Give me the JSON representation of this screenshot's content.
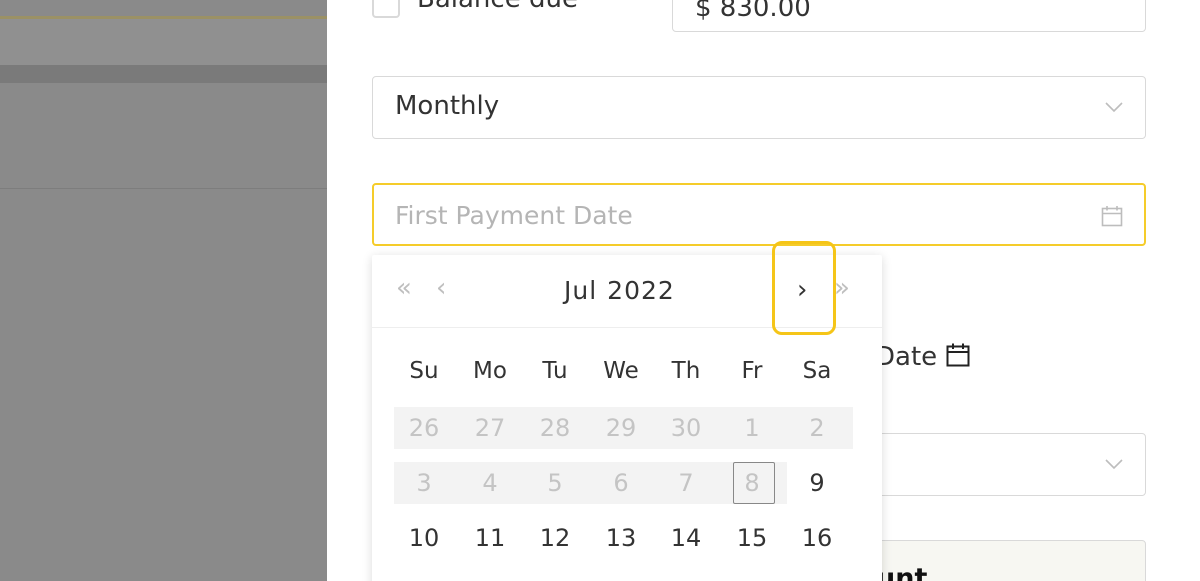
{
  "form": {
    "balance_label": "Balance due",
    "balance_value": "$ 830.00",
    "frequency_value": "Monthly",
    "first_payment_placeholder": "First Payment Date",
    "second_date_label": "Date",
    "partial_button_text": "unt"
  },
  "calendar": {
    "month": "Jul",
    "year": "2022",
    "nav": {
      "prev_year": "«",
      "prev_month": "‹",
      "next_month": "›",
      "next_year": "»"
    },
    "weekdays": [
      "Su",
      "Mo",
      "Tu",
      "We",
      "Th",
      "Fr",
      "Sa"
    ],
    "weeks": [
      [
        "26",
        "27",
        "28",
        "29",
        "30",
        "1",
        "2"
      ],
      [
        "3",
        "4",
        "5",
        "6",
        "7",
        "8",
        "9"
      ],
      [
        "10",
        "11",
        "12",
        "13",
        "14",
        "15",
        "16"
      ]
    ],
    "today": "8"
  },
  "colors": {
    "focus": "#f5c518",
    "input_focus_border": "#f5cc2a",
    "backdrop": "#8a8a8a"
  }
}
